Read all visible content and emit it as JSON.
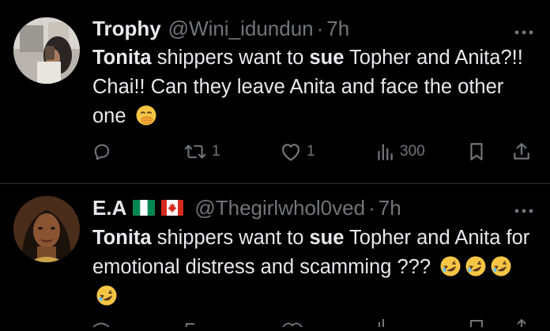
{
  "tweets": [
    {
      "display_name": "Trophy",
      "handle": "@Wini_idundun",
      "separator": "·",
      "time": "7h",
      "segments": [
        {
          "text": "Tonita",
          "bold": true
        },
        {
          "text": " shippers want to ",
          "bold": false
        },
        {
          "text": "sue",
          "bold": true
        },
        {
          "text": " Topher and Anita?!! Chai!! Can they leave Anita and face the other one ",
          "bold": false
        }
      ],
      "emojis": [
        "face-with-hand-over-mouth-emoji"
      ],
      "actions": {
        "replies": "",
        "reposts": "1",
        "likes": "1",
        "views": "300"
      }
    },
    {
      "display_name": "E.A",
      "flags": [
        "nigeria-flag",
        "canada-flag"
      ],
      "handle": "@Thegirlwhol0ved",
      "separator": "·",
      "time": "7h",
      "segments": [
        {
          "text": "Tonita",
          "bold": true
        },
        {
          "text": " shippers want to ",
          "bold": false
        },
        {
          "text": "sue",
          "bold": true
        },
        {
          "text": " Topher and Anita for emotional distress and scamming ??? ",
          "bold": false
        }
      ],
      "emojis": [
        "rolling-on-floor-laughing-emoji",
        "rolling-on-floor-laughing-emoji",
        "rolling-on-floor-laughing-emoji",
        "rolling-on-floor-laughing-emoji"
      ]
    }
  ],
  "colors": {
    "background": "#000000",
    "primary_text": "#e7e9ea",
    "secondary_text": "#71767b",
    "divider": "#2f3336",
    "emoji_yellow": "#f7c544"
  }
}
